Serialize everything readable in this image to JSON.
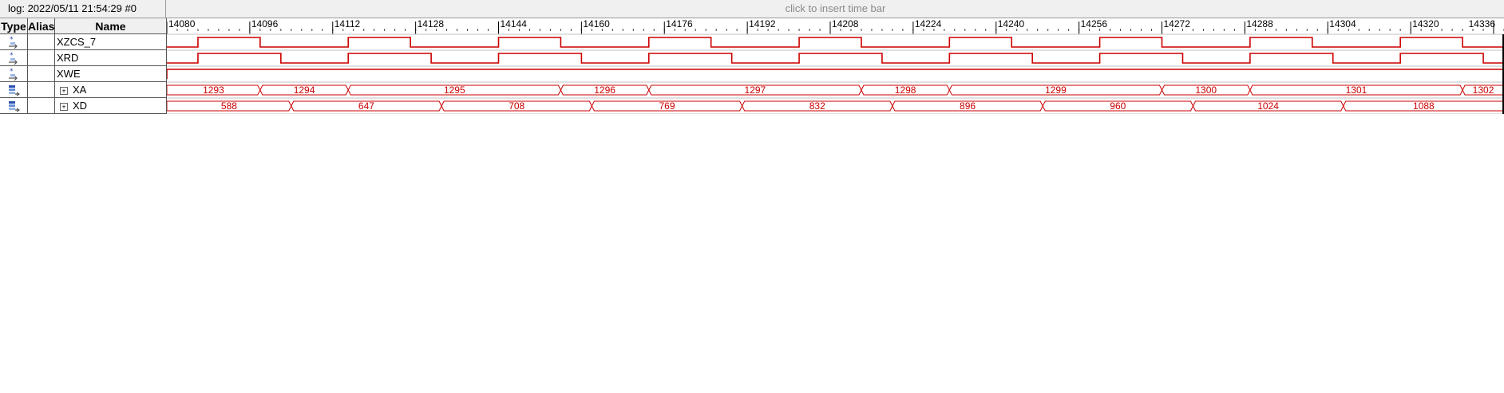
{
  "header": {
    "log_info": "log: 2022/05/11 21:54:29  #0",
    "insert_time_bar": "click to insert time bar"
  },
  "columns": {
    "type": "Type",
    "alias": "Alias",
    "name": "Name"
  },
  "timeline": {
    "start": 14080,
    "end": 14338,
    "ticks": [
      "14080",
      "14096",
      "14112",
      "14128",
      "14144",
      "14160",
      "14176",
      "14192",
      "14208",
      "14224",
      "14240",
      "14256",
      "14272",
      "14288",
      "14304",
      "14320",
      "14336"
    ]
  },
  "colors": {
    "waveform": "#cc0000",
    "grid": "#555555",
    "header_bg": "#f0f0f0"
  },
  "signals": [
    {
      "name": "XZCS_7",
      "type_icon": "bit-signal-icon",
      "kind": "bit",
      "high": [
        [
          14086,
          14098
        ],
        [
          14115,
          14127
        ],
        [
          14144,
          14156
        ],
        [
          14173,
          14185
        ],
        [
          14202,
          14214
        ],
        [
          14231,
          14243
        ],
        [
          14260,
          14272
        ],
        [
          14289,
          14301
        ],
        [
          14318,
          14330
        ]
      ]
    },
    {
      "name": "XRD",
      "type_icon": "bit-signal-icon",
      "kind": "bit",
      "high": [
        [
          14086,
          14102
        ],
        [
          14115,
          14131
        ],
        [
          14144,
          14160
        ],
        [
          14173,
          14189
        ],
        [
          14202,
          14218
        ],
        [
          14231,
          14247
        ],
        [
          14260,
          14276
        ],
        [
          14289,
          14305
        ],
        [
          14318,
          14334
        ]
      ]
    },
    {
      "name": "XWE",
      "type_icon": "bit-signal-icon",
      "kind": "bit",
      "high": [
        [
          14080,
          14338
        ]
      ]
    },
    {
      "name": "XA",
      "type_icon": "bus-signal-icon",
      "kind": "bus",
      "expander": "+",
      "segments": [
        {
          "start": 14080,
          "end": 14098,
          "value": "1293"
        },
        {
          "start": 14098,
          "end": 14115,
          "value": "1294"
        },
        {
          "start": 14115,
          "end": 14156,
          "value": "1295"
        },
        {
          "start": 14156,
          "end": 14173,
          "value": "1296"
        },
        {
          "start": 14173,
          "end": 14214,
          "value": "1297"
        },
        {
          "start": 14214,
          "end": 14231,
          "value": "1298"
        },
        {
          "start": 14231,
          "end": 14272,
          "value": "1299"
        },
        {
          "start": 14272,
          "end": 14289,
          "value": "1300"
        },
        {
          "start": 14289,
          "end": 14330,
          "value": "1301"
        },
        {
          "start": 14330,
          "end": 14338,
          "value": "1302"
        }
      ]
    },
    {
      "name": "XD",
      "type_icon": "bus-signal-icon",
      "kind": "bus",
      "expander": "+",
      "segments": [
        {
          "start": 14080,
          "end": 14104,
          "value": "588"
        },
        {
          "start": 14104,
          "end": 14133,
          "value": "647"
        },
        {
          "start": 14133,
          "end": 14162,
          "value": "708"
        },
        {
          "start": 14162,
          "end": 14191,
          "value": "769"
        },
        {
          "start": 14191,
          "end": 14220,
          "value": "832"
        },
        {
          "start": 14220,
          "end": 14249,
          "value": "896"
        },
        {
          "start": 14249,
          "end": 14278,
          "value": "960"
        },
        {
          "start": 14278,
          "end": 14307,
          "value": "1024"
        },
        {
          "start": 14307,
          "end": 14338,
          "value": "1088"
        }
      ]
    }
  ]
}
